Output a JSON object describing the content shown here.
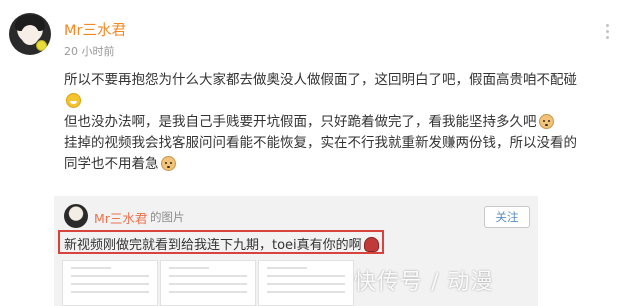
{
  "post": {
    "username": "Mr三水君",
    "timestamp": "20 小时前",
    "paragraphs": [
      "所以不要再抱怨为什么大家都去做奥没人做假面了，这回明白了吧，假面高贵咱不配碰",
      "但也没办法啊，是我自己手贱要开坑假面，只好跪着做完了，看我能坚持多久吧",
      "挂掉的视频我会找客服问问看能不能恢复，实在不行我就重新发赚两份钱，所以没看的同学也不用着急"
    ],
    "icons": [
      "grin-emoji",
      "dog-emoji",
      "dog-emoji"
    ]
  },
  "quote": {
    "username": "Mr三水君",
    "meta": "的图片",
    "follow_label": "关注",
    "text": "新视频刚做完就看到给我连下九期，toei真有你的啊"
  },
  "watermark": "快传号 / 动漫",
  "colors": {
    "username": "#f08a24",
    "quote_username": "#eb7350",
    "highlight": "#d9433e"
  }
}
